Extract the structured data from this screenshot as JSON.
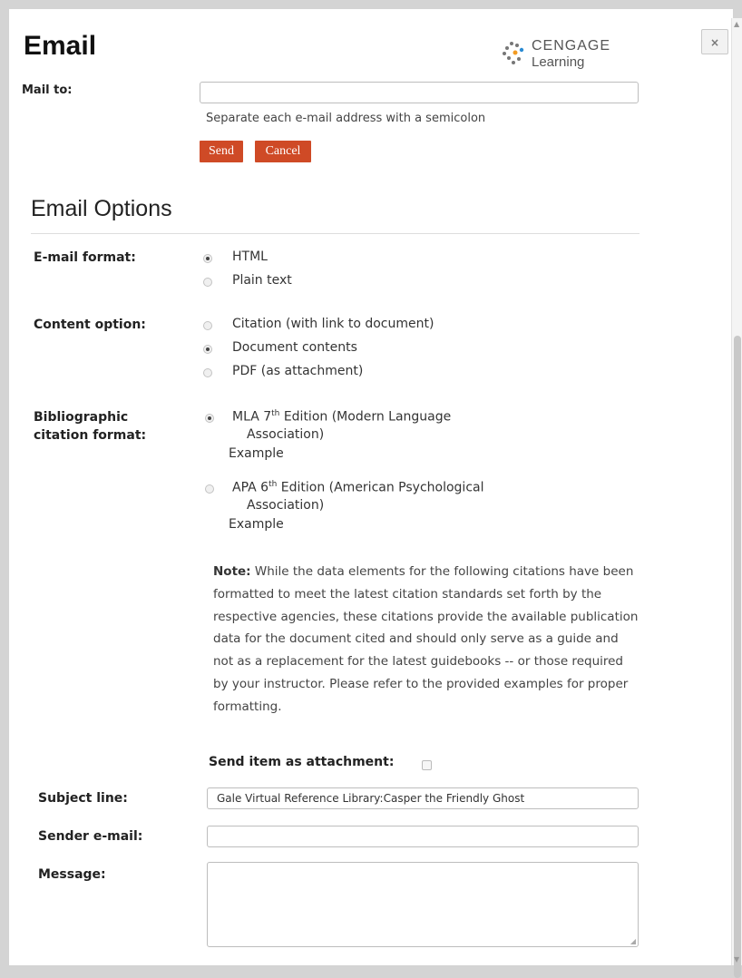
{
  "dialog": {
    "title": "Email",
    "close_label": "×"
  },
  "logo": {
    "line1": "CENGAGE",
    "line2": "Learning"
  },
  "mail_to": {
    "label": "Mail to:",
    "value": "",
    "hint": "Separate each e-mail address with a semicolon"
  },
  "buttons": {
    "send": "Send",
    "cancel": "Cancel"
  },
  "options": {
    "title": "Email Options",
    "email_format": {
      "label": "E-mail format:",
      "choices": [
        {
          "label": "HTML",
          "selected": true
        },
        {
          "label": "Plain text",
          "selected": false
        }
      ]
    },
    "content_option": {
      "label": "Content option:",
      "choices": [
        {
          "label": "Citation (with link to document)",
          "selected": false
        },
        {
          "label": "Document contents",
          "selected": true
        },
        {
          "label": "PDF (as attachment)",
          "selected": false
        }
      ]
    },
    "citation_format": {
      "label_line1": "Bibliographic",
      "label_line2": "citation format:",
      "choices": [
        {
          "prefix": "MLA 7",
          "sup": "th",
          "line1_rest": " Edition (Modern Language",
          "line2": "Association)",
          "example": "Example",
          "selected": true
        },
        {
          "prefix": "APA 6",
          "sup": "th",
          "line1_rest": " Edition (American Psychological",
          "line2": "Association)",
          "example": "Example",
          "selected": false
        }
      ]
    },
    "note": {
      "bold": "Note:",
      "text": " While the data elements for the following citations have been formatted to meet the latest citation standards set forth by the respective agencies, these citations provide the available publication data for the document cited and should only serve as a guide and not as a replacement for the latest guidebooks -- or those required by your instructor. Please refer to the provided examples for proper formatting."
    }
  },
  "attachment": {
    "label": "Send item as attachment:",
    "checked": false
  },
  "subject": {
    "label": "Subject line:",
    "value": "Gale Virtual Reference Library:Casper the Friendly Ghost"
  },
  "sender": {
    "label": "Sender e-mail:",
    "value": ""
  },
  "message": {
    "label": "Message:",
    "value": ""
  },
  "colors": {
    "button_bg": "#cf4a26",
    "background": "#ffffff"
  }
}
